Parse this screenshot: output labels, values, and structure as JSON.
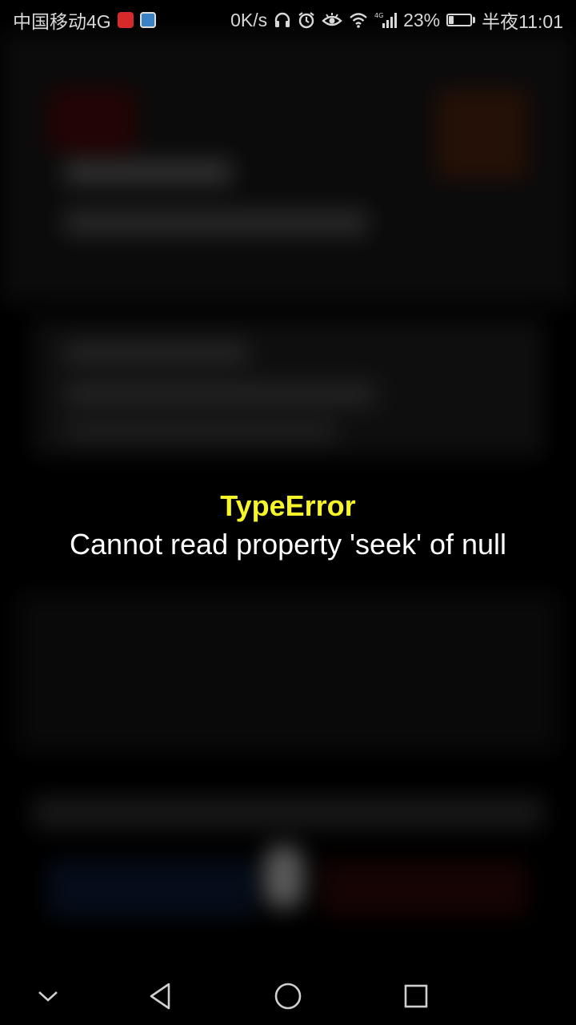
{
  "status_bar": {
    "carrier": "中国移动4G",
    "app_badges": [
      "news-app-icon",
      "browser-app-icon"
    ],
    "net_speed": "0K/s",
    "icons": [
      "headphones-icon",
      "alarm-icon",
      "eye-comfort-icon",
      "wifi-icon",
      "signal-4g-icon"
    ],
    "battery_percent_label": "23%",
    "battery_level": 0.23,
    "time": "半夜11:01"
  },
  "error": {
    "type": "TypeError",
    "message": "Cannot read property 'seek' of null",
    "type_color": "#f5f528",
    "message_color": "#ffffff"
  },
  "nav_bar": {
    "buttons": [
      "collapse-icon",
      "back-icon",
      "home-icon",
      "recents-icon"
    ]
  }
}
